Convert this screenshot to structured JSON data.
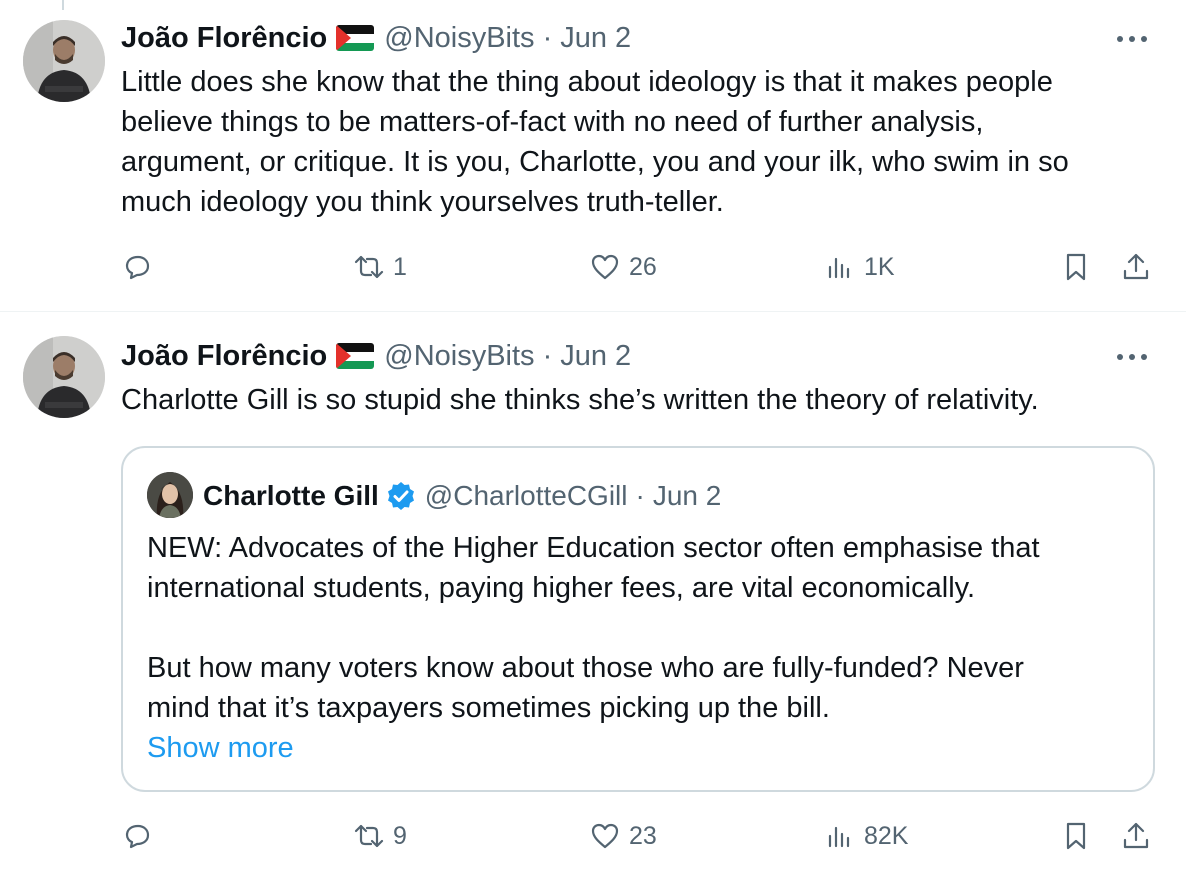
{
  "tweets": [
    {
      "author_name": "João Florêncio",
      "handle": "@NoisyBits",
      "separator": "·",
      "date": "Jun 2",
      "text_lines": [
        "Little does she know that the thing about ideology is that it makes people",
        "believe things to be matters-of-fact with no need of further analysis,",
        "argument, or critique. It is you, Charlotte, you and your ilk, who swim in so",
        "much ideology you think yourselves truth-teller."
      ],
      "replies": "",
      "reposts": "1",
      "likes": "26",
      "views": "1K"
    },
    {
      "author_name": "João Florêncio",
      "handle": "@NoisyBits",
      "separator": "·",
      "date": "Jun 2",
      "text_lines": [
        "Charlotte Gill is so stupid she thinks she’s written the theory of relativity."
      ],
      "quoted": {
        "author_name": "Charlotte Gill",
        "handle": "@CharlotteCGill",
        "separator": "·",
        "date": "Jun 2",
        "paragraph1_lines": [
          "NEW: Advocates of the Higher Education sector often emphasise that",
          "international students, paying higher fees, are vital economically."
        ],
        "paragraph2_lines": [
          "But how many voters know about those who are fully-funded? Never",
          "mind that it’s taxpayers sometimes picking up the bill."
        ],
        "show_more": "Show more"
      },
      "replies": "",
      "reposts": "9",
      "likes": "23",
      "views": "82K"
    }
  ],
  "colors": {
    "text": "#0f1419",
    "secondary": "#536471",
    "link": "#1d9bf0",
    "border": "#cfd9de",
    "verified": "#1d9bf0"
  },
  "icons": [
    "reply-icon",
    "repost-icon",
    "like-icon",
    "views-icon",
    "bookmark-icon",
    "share-icon",
    "more-icon",
    "verified-badge-icon",
    "palestine-flag-icon"
  ]
}
